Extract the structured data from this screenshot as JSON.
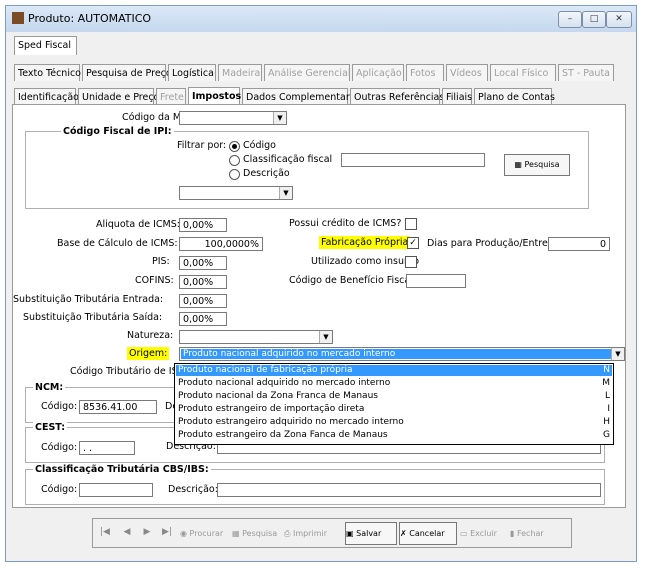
{
  "window": {
    "title": "Produto: AUTOMATICO"
  },
  "tabs_row1": [
    "Sped Fiscal"
  ],
  "tabs_row2": [
    "Texto Técnico",
    "Pesquisa de Preço",
    "Logística",
    "Madeira",
    "Análise Gerencial",
    "Aplicação",
    "Fotos",
    "Vídeos",
    "Local Físico",
    "ST - Pauta"
  ],
  "tabs_row3": [
    "Identificação",
    "Unidade e Preço",
    "Frete",
    "Impostos",
    "Dados Complementares",
    "Outras Referências",
    "Filiais",
    "Plano de Contas"
  ],
  "form": {
    "codigo_mensagem_label": "Código da Mensagem:",
    "ipi_group_title": "Código Fiscal de IPI:",
    "filtrar_label": "Filtrar por:",
    "radio_codigo": "Código",
    "radio_classificacao": "Classificação fiscal",
    "radio_descricao": "Descrição",
    "pesquisa_button": "Pesquisa",
    "aliquota_icms_label": "Aliquota de ICMS:",
    "aliquota_icms_value": "0,00%",
    "base_calculo_label": "Base de Cálculo de ICMS:",
    "base_calculo_value": "100,0000%",
    "pis_label": "PIS:",
    "pis_value": "0,00%",
    "cofins_label": "COFINS:",
    "cofins_value": "0,00%",
    "subst_entrada_label": "Substituição Tributária Entrada:",
    "subst_entrada_value": "0,00%",
    "subst_saida_label": "Substituição Tributária Saída:",
    "subst_saida_value": "0,00%",
    "natureza_label": "Natureza:",
    "origem_label": "Origem:",
    "origem_value": "Produto nacional adquirido no mercado interno",
    "cod_trib_iss_label": "Código Tributário de ISS:",
    "credito_icms_label": "Possui crédito de ICMS?",
    "fabricacao_propria_label": "Fabricação Própria",
    "dias_producao_label": "Dias para Produção/Entrega:",
    "dias_producao_value": "0",
    "utilizado_insumo_label": "Utilizado como insumo",
    "beneficio_fiscal_label": "Código de Benefício Fiscal:",
    "ncm_title": "NCM:",
    "ncm_codigo_label": "Código:",
    "ncm_codigo_value": "8536.41.00",
    "ncm_desc_label": "De",
    "cest_title": "CEST:",
    "cest_codigo_label": "Código:",
    "cest_codigo_value": ". .",
    "cest_desc_label": "Descrição:",
    "cbs_title": "Classificação Tributária CBS/IBS:",
    "cbs_codigo_label": "Código:",
    "cbs_desc_label": "Descrição:"
  },
  "origem_options": [
    {
      "label": "Produto nacional de fabricação própria",
      "code": "N"
    },
    {
      "label": "Produto nacional adquirido no mercado interno",
      "code": "M"
    },
    {
      "label": "Produto nacional da Zona Franca de Manaus",
      "code": "L"
    },
    {
      "label": "Produto estrangeiro de importação direta",
      "code": "I"
    },
    {
      "label": "Produto estrangeiro adquirido no mercado interno",
      "code": "H"
    },
    {
      "label": "Produto estrangeiro da Zona Fanca de Manaus",
      "code": "G"
    }
  ],
  "toolbar": {
    "procurar": "Procurar",
    "pesquisa": "Pesquisa",
    "imprimir": "Imprimir",
    "salvar": "Salvar",
    "cancelar": "Cancelar",
    "excluir": "Excluir",
    "fechar": "Fechar"
  },
  "colors": {
    "highlight": "#ffff00",
    "selection": "#3399ff",
    "titlebar": "#c5d8ee"
  }
}
